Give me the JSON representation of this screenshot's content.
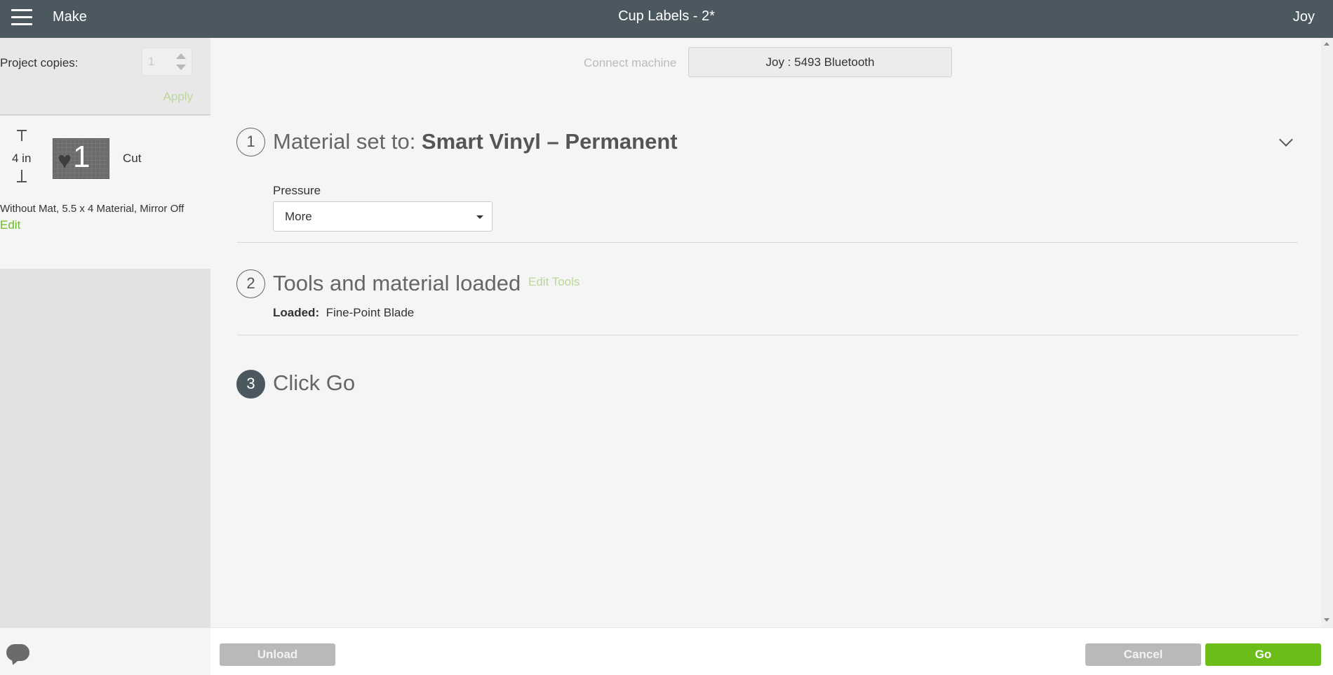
{
  "topbar": {
    "menu_icon": "hamburger-menu-icon",
    "section": "Make",
    "project_title": "Cup Labels - 2*",
    "user_name": "Joy"
  },
  "sidebar": {
    "copies_label": "Project copies:",
    "copies_value": "1",
    "apply_label": "Apply",
    "mat": {
      "dimension": "4 in",
      "number": "1",
      "operation": "Cut",
      "description": "Without Mat, 5.5 x 4 Material, Mirror Off",
      "edit_label": "Edit"
    }
  },
  "main": {
    "connect_label": "Connect machine",
    "machine_name": "Joy : 5493 Bluetooth",
    "steps": [
      {
        "number": "1",
        "title_prefix": "Material set to: ",
        "title_value": "Smart Vinyl – Permanent"
      },
      {
        "number": "2",
        "title": "Tools and material loaded",
        "link": "Edit Tools"
      },
      {
        "number": "3",
        "title": "Click Go"
      }
    ],
    "pressure": {
      "label": "Pressure",
      "selected": "More"
    },
    "loaded": {
      "label": "Loaded:",
      "value": "Fine-Point Blade"
    }
  },
  "bottombar": {
    "unload_label": "Unload",
    "cancel_label": "Cancel",
    "go_label": "Go"
  },
  "colors": {
    "topbar": "#4c5860",
    "accent_green": "#6cbd1a",
    "disabled_button": "#b9b9b9",
    "link_disabled": "#bcd79a"
  }
}
